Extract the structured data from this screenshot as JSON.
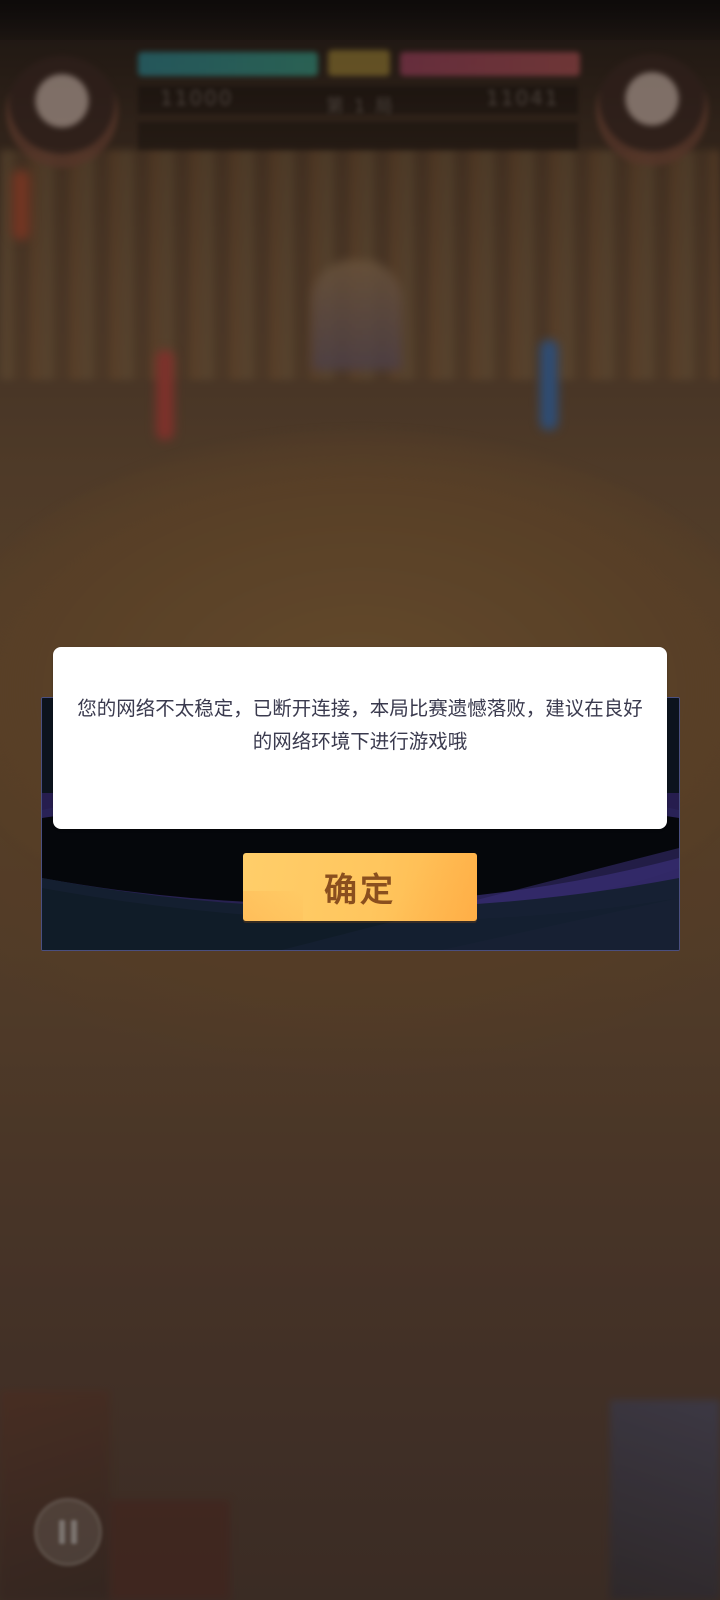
{
  "dialog": {
    "message": "您的网络不太稳定，已断开连接，本局比赛遗憾落败，建议在良好的网络环境下进行游戏哦",
    "confirm_label": "确定"
  },
  "background": {
    "hud_left_score": "11000",
    "hud_right_score": "11041",
    "hud_round": "第 1 局"
  },
  "colors": {
    "confirm_button": "#ffc65e",
    "confirm_text": "#8a4f1e",
    "card_background": "#ffffff",
    "dialog_border": "#4a4f80"
  },
  "icons": {
    "pause": "pause-icon"
  }
}
